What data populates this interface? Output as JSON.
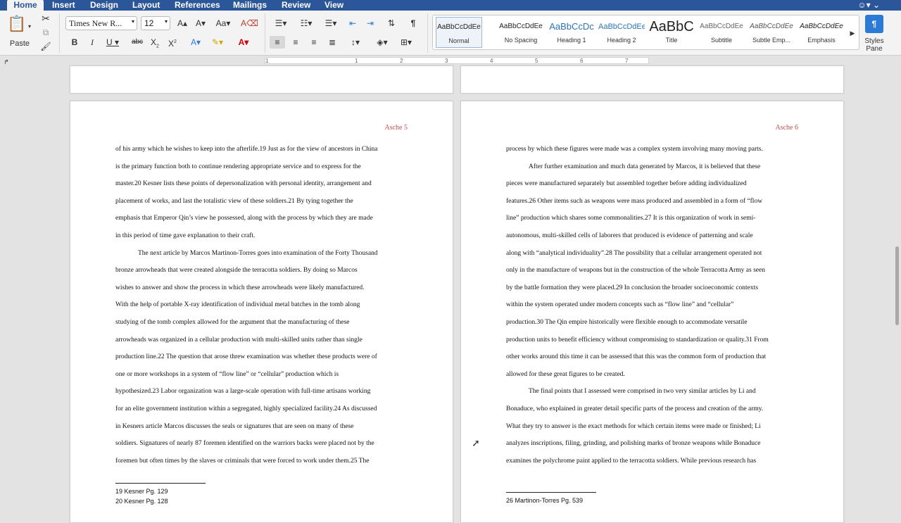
{
  "menu": {
    "tabs": [
      "Home",
      "Insert",
      "Design",
      "Layout",
      "References",
      "Mailings",
      "Review",
      "View"
    ]
  },
  "ribbon": {
    "paste_label": "Paste",
    "font_name": "Times New R...",
    "font_size": "12",
    "styles": [
      "Normal",
      "No Spacing",
      "Heading 1",
      "Heading 2",
      "Title",
      "Subtitle",
      "Subtle Emp...",
      "Emphasis"
    ],
    "style_previews": [
      "AaBbCcDdEe",
      "AaBbCcDdEe",
      "AaBbCcDc",
      "AaBbCcDdEe",
      "AaBbC",
      "AaBbCcDdEe",
      "AaBbCcDdEe",
      "AaBbCcDdEe"
    ],
    "styles_pane_label": "Styles Pane"
  },
  "ruler": {
    "marks": [
      "1",
      "1",
      "2",
      "3",
      "4",
      "5",
      "6",
      "7"
    ]
  },
  "doc": {
    "page5": {
      "header": "Asche 5",
      "lines": [
        "of his army which he wishes to keep into the afterlife.19 Just as for the view of ancestors in China",
        "is the primary function both to continue rendering appropriate service and to express for the",
        "master.20  Kesner lists these points of depersonalization with personal identity, arrangement and",
        "placement of works, and last the totalistic view of these soldiers.21 By tying together the",
        "emphasis that Emperor Qin’s view he possessed, along with the process by which they are made",
        "in this period of time gave explanation to their craft.",
        "The next article by Marcos Martinon-Torres goes into examination of the Forty Thousand",
        "bronze arrowheads that were created alongside the terracotta soldiers. By doing so Marcos",
        "wishes to answer and show the process in which these arrowheads were likely manufactured.",
        "With the help of portable X-ray identification of individual metal batches in the tomb along",
        "studying of the tomb complex allowed for the argument that the manufacturing of these",
        "arrowheads was organized in a cellular production with multi-skilled units rather than single",
        "production line.22 The question that arose threw examination was whether these products were of",
        "one or more workshops in a system of “flow line” or “cellular” production which is",
        "hypothesized.23 Labor organization was a large-scale operation with full-time artisans working",
        "for an elite government institution within a segregated, highly specialized facility.24 As discussed",
        "in Kesners article Marcos discusses the seals or signatures that are seen on many of these",
        "soldiers. Signatures of nearly 87 foremen identified on the warriors backs were placed not by the",
        "foremen but often times by the slaves or criminals that were forced to work under them.25 The"
      ],
      "footnotes": [
        "19 Kesner Pg. 129",
        "20 Kesner Pg. 128"
      ]
    },
    "page6": {
      "header": "Asche 6",
      "lines": [
        "process by which these figures were made was a complex system involving many moving parts.",
        "After further examination and much data generated by Marcos, it is believed that these",
        "pieces were manufactured separately but assembled together before adding individualized",
        "features.26 Other items such as weapons were mass produced and assembled in a form of “flow",
        "line” production which shares some commonalities.27 It is this organization of work in semi-",
        "autonomous, multi-skilled cells of laborers that produced is evidence of patterning and scale",
        "along with “analytical individuality”.28 The possibility that a cellular arrangement operated not",
        "only in the manufacture of weapons but in the construction of the whole Terracotta Army as seen",
        "by the battle formation they were placed.29 In conclusion the broader socioeconomic contexts",
        "within the system operated under modern concepts such as “flow line” and “cellular”",
        "production.30 The Qin empire historically were flexible enough to accommodate versatile",
        "production units to benefit efficiency without compromising to standardization or quality.31 From",
        "other works around this time it can be assessed that this was the common form of production that",
        "allowed for these great figures to be created.",
        "The final points that I assessed were comprised in two very similar articles by Li and",
        "Bonaduce, who explained in greater detail specific parts of the process and creation of the army.",
        "What they try to answer is the exact methods for which certain items were made or finished; Li",
        "analyzes inscriptions, filing, grinding, and polishing marks of bronze weapons while Bonaduce",
        "examines the polychrome paint applied to the terracotta soldiers. While previous research has"
      ],
      "footnotes": [
        "26 Martinon-Torres Pg. 539"
      ]
    }
  }
}
